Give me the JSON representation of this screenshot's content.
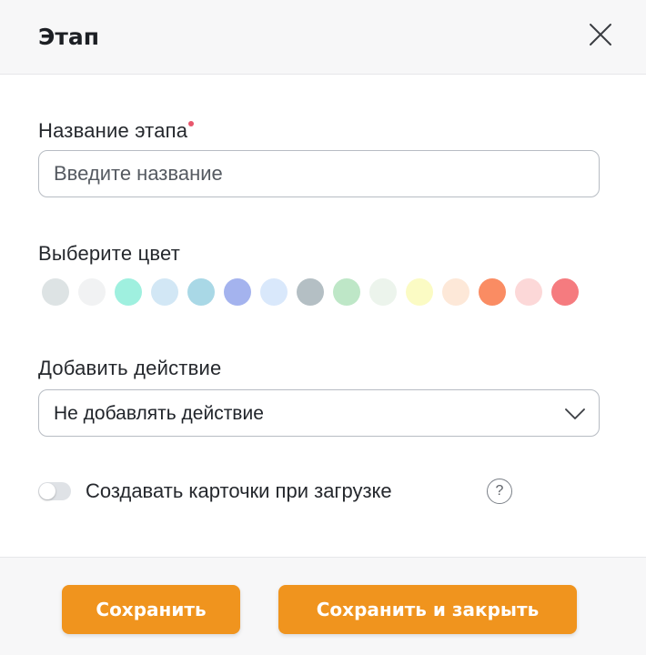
{
  "header": {
    "title": "Этап"
  },
  "form": {
    "name_label": "Название этапа",
    "name_placeholder": "Введите название",
    "color_label": "Выберите цвет",
    "colors": [
      "#dde3e4",
      "#f1f2f3",
      "#9ff0df",
      "#d2e7f5",
      "#a9d8e6",
      "#a4b3ee",
      "#d9e8fb",
      "#b4bfc4",
      "#bee7c7",
      "#ecf4ec",
      "#fbfbc4",
      "#fde8d8",
      "#fa8c63",
      "#fcd8d8",
      "#f57b7f"
    ],
    "action_label": "Добавить действие",
    "action_value": "Не добавлять действие",
    "toggle_label": "Создавать карточки при загрузке",
    "toggle_on": false,
    "help_symbol": "?"
  },
  "footer": {
    "save_label": "Сохранить",
    "save_close_label": "Сохранить и закрыть"
  },
  "accent_color": "#f0941e"
}
